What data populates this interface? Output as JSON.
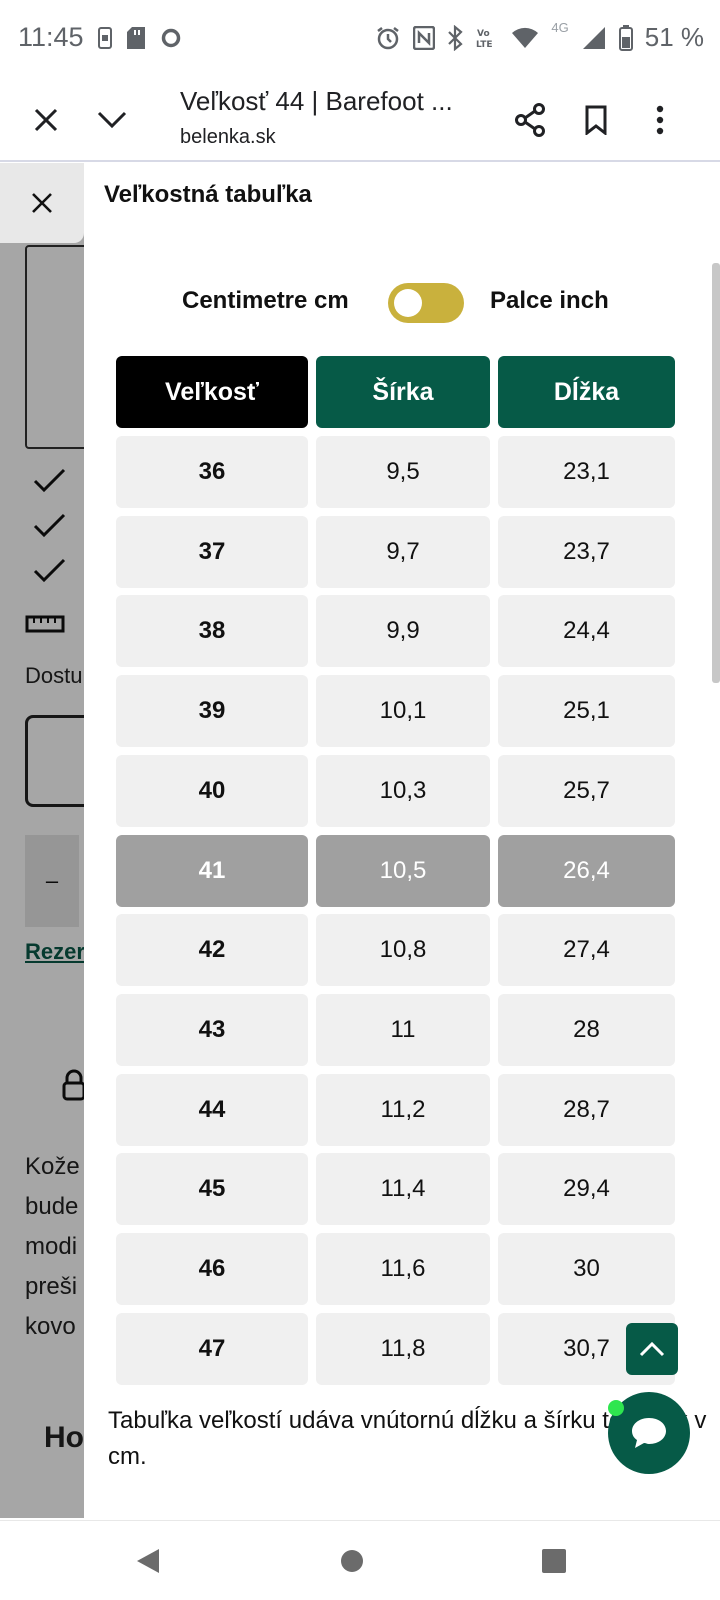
{
  "status_bar": {
    "time": "11:45",
    "battery": "51 %",
    "network": "4G",
    "icons": [
      "sim-icon",
      "sd-card-icon",
      "circle-icon",
      "alarm-icon",
      "nfc-icon",
      "bluetooth-icon",
      "volte-icon",
      "wifi-icon",
      "signal-icon",
      "battery-icon"
    ]
  },
  "browser": {
    "title": "Veľkosť 44 | Barefoot ...",
    "url": "belenka.sk",
    "icons": [
      "close-icon",
      "chevron-down-icon",
      "share-icon",
      "bookmark-icon",
      "more-vert-icon"
    ]
  },
  "background_page": {
    "texts": [
      "Dostu",
      "Rezer",
      "Kože",
      "bude",
      "modi",
      "preši",
      "kovo",
      "Ho"
    ],
    "minus_label": "–"
  },
  "modal": {
    "title": "Veľkostná tabuľka",
    "unit_left": "Centimetre cm",
    "unit_right": "Palce inch",
    "toggle_state": "cm",
    "headers": [
      "Veľkosť",
      "Šírka",
      "Dĺžka"
    ],
    "highlighted_size": "41",
    "rows": [
      {
        "size": "36",
        "width": "9,5",
        "length": "23,1"
      },
      {
        "size": "37",
        "width": "9,7",
        "length": "23,7"
      },
      {
        "size": "38",
        "width": "9,9",
        "length": "24,4"
      },
      {
        "size": "39",
        "width": "10,1",
        "length": "25,1"
      },
      {
        "size": "40",
        "width": "10,3",
        "length": "25,7"
      },
      {
        "size": "41",
        "width": "10,5",
        "length": "26,4"
      },
      {
        "size": "42",
        "width": "10,8",
        "length": "27,4"
      },
      {
        "size": "43",
        "width": "11",
        "length": "28"
      },
      {
        "size": "44",
        "width": "11,2",
        "length": "28,7"
      },
      {
        "size": "45",
        "width": "11,4",
        "length": "29,4"
      },
      {
        "size": "46",
        "width": "11,6",
        "length": "30"
      },
      {
        "size": "47",
        "width": "11,8",
        "length": "30,7"
      }
    ],
    "note": "Tabuľka veľkostí udáva vnútornú dĺžku a šírku topánok v cm."
  },
  "colors": {
    "accent_green": "#065a47",
    "toggle_yellow": "#c9b13d",
    "highlight_gray": "#a0a0a0",
    "cell_gray": "#f0f0f0"
  }
}
